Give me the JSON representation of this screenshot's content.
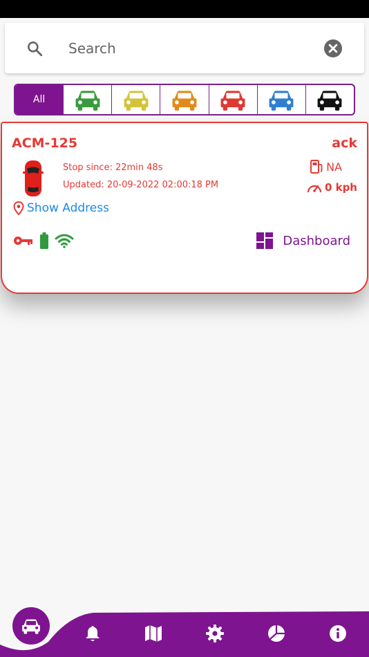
{
  "search": {
    "placeholder": "Search"
  },
  "filters": {
    "all_label": "All",
    "car_colors": [
      "#3a9b3e",
      "#d4c33a",
      "#e28a19",
      "#dd3a34",
      "#2f7fd1",
      "#111111"
    ]
  },
  "vehicle": {
    "plate": "ACM-125",
    "ack": "ack",
    "stop_since": "Stop since: 22min 48s",
    "updated": "Updated: 20-09-2022 02:00:18 PM",
    "fuel": "NA",
    "speed": "0 kph",
    "show_address": "Show Address",
    "dashboard_label": "Dashboard"
  },
  "colors": {
    "accent": "#7e148f",
    "alert": "#e53935",
    "link": "#1e88e5",
    "ok": "#2e9b3e"
  },
  "nav": {
    "items": [
      "car-icon",
      "bell-icon",
      "map-icon",
      "gear-icon",
      "pie-chart-icon",
      "info-icon"
    ]
  }
}
